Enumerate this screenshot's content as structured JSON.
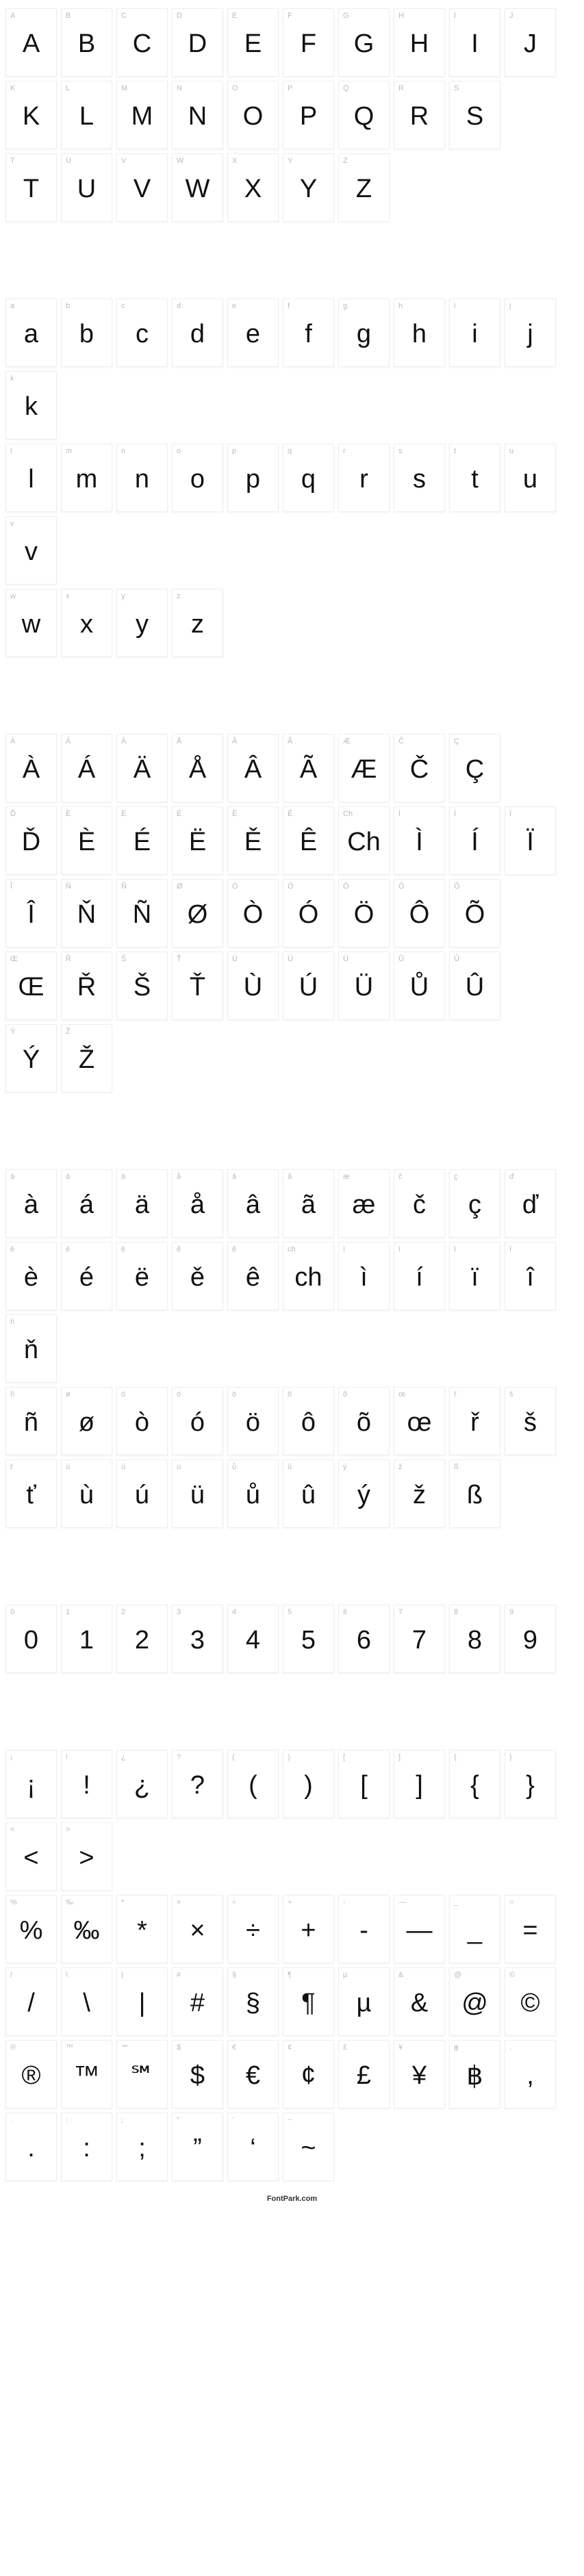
{
  "footer": "FontPark.com",
  "rows": [
    [
      {
        "s": "A",
        "b": "A"
      },
      {
        "s": "B",
        "b": "B"
      },
      {
        "s": "C",
        "b": "C"
      },
      {
        "s": "D",
        "b": "D"
      },
      {
        "s": "E",
        "b": "E"
      },
      {
        "s": "F",
        "b": "F"
      },
      {
        "s": "G",
        "b": "G"
      },
      {
        "s": "H",
        "b": "H"
      },
      {
        "s": "I",
        "b": "I"
      },
      {
        "s": "J",
        "b": "J"
      }
    ],
    [
      {
        "s": "K",
        "b": "K"
      },
      {
        "s": "L",
        "b": "L"
      },
      {
        "s": "M",
        "b": "M"
      },
      {
        "s": "N",
        "b": "N"
      },
      {
        "s": "O",
        "b": "O"
      },
      {
        "s": "P",
        "b": "P"
      },
      {
        "s": "Q",
        "b": "Q"
      },
      {
        "s": "R",
        "b": "R"
      },
      {
        "s": "S",
        "b": "S"
      }
    ],
    [
      {
        "s": "T",
        "b": "T"
      },
      {
        "s": "U",
        "b": "U"
      },
      {
        "s": "V",
        "b": "V"
      },
      {
        "s": "W",
        "b": "W"
      },
      {
        "s": "X",
        "b": "X"
      },
      {
        "s": "Y",
        "b": "Y"
      },
      {
        "s": "Z",
        "b": "Z"
      }
    ],
    [],
    [
      {
        "s": "a",
        "b": "a"
      },
      {
        "s": "b",
        "b": "b"
      },
      {
        "s": "c",
        "b": "c"
      },
      {
        "s": "d",
        "b": "d"
      },
      {
        "s": "e",
        "b": "e"
      },
      {
        "s": "f",
        "b": "f"
      },
      {
        "s": "g",
        "b": "g"
      },
      {
        "s": "h",
        "b": "h"
      },
      {
        "s": "i",
        "b": "i"
      },
      {
        "s": "j",
        "b": "j"
      },
      {
        "s": "k",
        "b": "k"
      }
    ],
    [
      {
        "s": "l",
        "b": "l"
      },
      {
        "s": "m",
        "b": "m"
      },
      {
        "s": "n",
        "b": "n"
      },
      {
        "s": "o",
        "b": "o"
      },
      {
        "s": "p",
        "b": "p"
      },
      {
        "s": "q",
        "b": "q"
      },
      {
        "s": "r",
        "b": "r"
      },
      {
        "s": "s",
        "b": "s"
      },
      {
        "s": "t",
        "b": "t"
      },
      {
        "s": "u",
        "b": "u"
      },
      {
        "s": "v",
        "b": "v"
      }
    ],
    [
      {
        "s": "w",
        "b": "w"
      },
      {
        "s": "x",
        "b": "x"
      },
      {
        "s": "y",
        "b": "y"
      },
      {
        "s": "z",
        "b": "z"
      }
    ],
    [],
    [
      {
        "s": "À",
        "b": "À"
      },
      {
        "s": "Á",
        "b": "Á"
      },
      {
        "s": "Ä",
        "b": "Ä"
      },
      {
        "s": "Å",
        "b": "Å"
      },
      {
        "s": "Â",
        "b": "Â"
      },
      {
        "s": "Ã",
        "b": "Ã"
      },
      {
        "s": "Æ",
        "b": "Æ"
      },
      {
        "s": "Č",
        "b": "Č"
      },
      {
        "s": "Ç",
        "b": "Ç"
      }
    ],
    [
      {
        "s": "Ď",
        "b": "Ď"
      },
      {
        "s": "È",
        "b": "È"
      },
      {
        "s": "É",
        "b": "É"
      },
      {
        "s": "Ë",
        "b": "Ë"
      },
      {
        "s": "Ě",
        "b": "Ě"
      },
      {
        "s": "Ê",
        "b": "Ê"
      },
      {
        "s": "Ch",
        "b": "Ch"
      },
      {
        "s": "Ì",
        "b": "Ì"
      },
      {
        "s": "Í",
        "b": "Í"
      },
      {
        "s": "Ï",
        "b": "Ï"
      }
    ],
    [
      {
        "s": "Î",
        "b": "Î"
      },
      {
        "s": "Ň",
        "b": "Ň"
      },
      {
        "s": "Ñ",
        "b": "Ñ"
      },
      {
        "s": "Ø",
        "b": "Ø"
      },
      {
        "s": "Ò",
        "b": "Ò"
      },
      {
        "s": "Ó",
        "b": "Ó"
      },
      {
        "s": "Ö",
        "b": "Ö"
      },
      {
        "s": "Ô",
        "b": "Ô"
      },
      {
        "s": "Õ",
        "b": "Õ"
      }
    ],
    [
      {
        "s": "Œ",
        "b": "Œ"
      },
      {
        "s": "Ř",
        "b": "Ř"
      },
      {
        "s": "Š",
        "b": "Š"
      },
      {
        "s": "Ť",
        "b": "Ť"
      },
      {
        "s": "Ù",
        "b": "Ù"
      },
      {
        "s": "Ú",
        "b": "Ú"
      },
      {
        "s": "Ü",
        "b": "Ü"
      },
      {
        "s": "Ů",
        "b": "Ů"
      },
      {
        "s": "Û",
        "b": "Û"
      }
    ],
    [
      {
        "s": "Ý",
        "b": "Ý"
      },
      {
        "s": "Ž",
        "b": "Ž"
      }
    ],
    [],
    [
      {
        "s": "à",
        "b": "à"
      },
      {
        "s": "á",
        "b": "á"
      },
      {
        "s": "ä",
        "b": "ä"
      },
      {
        "s": "å",
        "b": "å"
      },
      {
        "s": "â",
        "b": "â"
      },
      {
        "s": "ã",
        "b": "ã"
      },
      {
        "s": "æ",
        "b": "æ"
      },
      {
        "s": "č",
        "b": "č"
      },
      {
        "s": "ç",
        "b": "ç"
      },
      {
        "s": "ď",
        "b": "ď"
      }
    ],
    [
      {
        "s": "è",
        "b": "è"
      },
      {
        "s": "é",
        "b": "é"
      },
      {
        "s": "ë",
        "b": "ë"
      },
      {
        "s": "ě",
        "b": "ě"
      },
      {
        "s": "ê",
        "b": "ê"
      },
      {
        "s": "ch",
        "b": "ch"
      },
      {
        "s": "ì",
        "b": "ì"
      },
      {
        "s": "í",
        "b": "í"
      },
      {
        "s": "ï",
        "b": "ï"
      },
      {
        "s": "î",
        "b": "î"
      },
      {
        "s": "ň",
        "b": "ň"
      }
    ],
    [
      {
        "s": "ñ",
        "b": "ñ"
      },
      {
        "s": "ø",
        "b": "ø"
      },
      {
        "s": "ò",
        "b": "ò"
      },
      {
        "s": "ó",
        "b": "ó"
      },
      {
        "s": "ö",
        "b": "ö"
      },
      {
        "s": "ô",
        "b": "ô"
      },
      {
        "s": "õ",
        "b": "õ"
      },
      {
        "s": "œ",
        "b": "œ"
      },
      {
        "s": "ř",
        "b": "ř"
      },
      {
        "s": "š",
        "b": "š"
      }
    ],
    [
      {
        "s": "ť",
        "b": "ť"
      },
      {
        "s": "ù",
        "b": "ù"
      },
      {
        "s": "ú",
        "b": "ú"
      },
      {
        "s": "ü",
        "b": "ü"
      },
      {
        "s": "ů",
        "b": "ů"
      },
      {
        "s": "û",
        "b": "û"
      },
      {
        "s": "ý",
        "b": "ý"
      },
      {
        "s": "ž",
        "b": "ž"
      },
      {
        "s": "ß",
        "b": "ß"
      }
    ],
    [],
    [
      {
        "s": "0",
        "b": "0"
      },
      {
        "s": "1",
        "b": "1"
      },
      {
        "s": "2",
        "b": "2"
      },
      {
        "s": "3",
        "b": "3"
      },
      {
        "s": "4",
        "b": "4"
      },
      {
        "s": "5",
        "b": "5"
      },
      {
        "s": "6",
        "b": "6"
      },
      {
        "s": "7",
        "b": "7"
      },
      {
        "s": "8",
        "b": "8"
      },
      {
        "s": "9",
        "b": "9"
      }
    ],
    [],
    [
      {
        "s": "¡",
        "b": "¡"
      },
      {
        "s": "!",
        "b": "!"
      },
      {
        "s": "¿",
        "b": "¿"
      },
      {
        "s": "?",
        "b": "?"
      },
      {
        "s": "(",
        "b": "("
      },
      {
        "s": ")",
        "b": ")"
      },
      {
        "s": "[",
        "b": "["
      },
      {
        "s": "]",
        "b": "]"
      },
      {
        "s": "{",
        "b": "{"
      },
      {
        "s": "}",
        "b": "}"
      },
      {
        "s": "<",
        "b": "<"
      },
      {
        "s": ">",
        "b": ">"
      }
    ],
    [
      {
        "s": "%",
        "b": "%"
      },
      {
        "s": "‰",
        "b": "‰"
      },
      {
        "s": "*",
        "b": "*"
      },
      {
        "s": "×",
        "b": "×"
      },
      {
        "s": "÷",
        "b": "÷"
      },
      {
        "s": "+",
        "b": "+"
      },
      {
        "s": "-",
        "b": "-"
      },
      {
        "s": "—",
        "b": "—"
      },
      {
        "s": "_",
        "b": "_"
      },
      {
        "s": "=",
        "b": "="
      }
    ],
    [
      {
        "s": "/",
        "b": "/"
      },
      {
        "s": "\\",
        "b": "\\"
      },
      {
        "s": "|",
        "b": "|"
      },
      {
        "s": "#",
        "b": "#"
      },
      {
        "s": "§",
        "b": "§"
      },
      {
        "s": "¶",
        "b": "¶"
      },
      {
        "s": "µ",
        "b": "µ"
      },
      {
        "s": "&",
        "b": "&"
      },
      {
        "s": "@",
        "b": "@"
      },
      {
        "s": "©",
        "b": "©"
      }
    ],
    [
      {
        "s": "®",
        "b": "®"
      },
      {
        "s": "™",
        "b": "™"
      },
      {
        "s": "℠",
        "b": "℠"
      },
      {
        "s": "$",
        "b": "$"
      },
      {
        "s": "€",
        "b": "€"
      },
      {
        "s": "¢",
        "b": "¢"
      },
      {
        "s": "£",
        "b": "£"
      },
      {
        "s": "¥",
        "b": "¥"
      },
      {
        "s": "฿",
        "b": "฿"
      },
      {
        "s": ",",
        "b": ","
      }
    ],
    [
      {
        "s": ".",
        "b": "."
      },
      {
        "s": ":",
        "b": ":"
      },
      {
        "s": ";",
        "b": ";"
      },
      {
        "s": "”",
        "b": "”"
      },
      {
        "s": "‘",
        "b": "‘"
      },
      {
        "s": "~",
        "b": "~"
      }
    ]
  ]
}
